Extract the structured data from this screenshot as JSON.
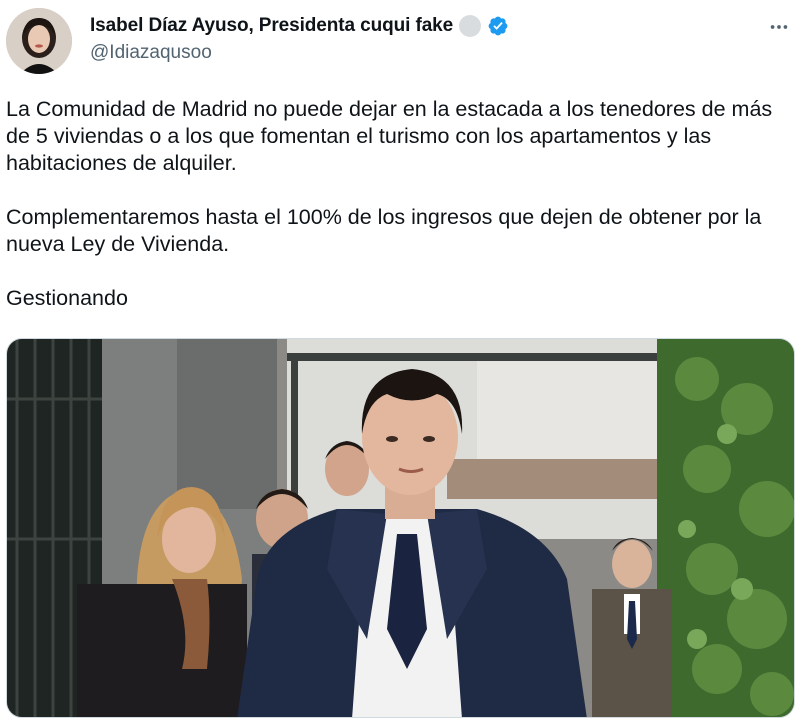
{
  "author": {
    "display_name": "Isabel Díaz Ayuso, Presidenta cuqui fake",
    "handle": "@Idiazaqusoo",
    "avatar_icon": "avatar-photo",
    "verified_icon": "verified-badge-icon",
    "badge_color": "#1d9bf0"
  },
  "tweet": {
    "paragraphs": [
      "La Comunidad de Madrid no puede dejar en la estacada a los tenedores de más de 5 viviendas o a los que fomentan el turismo con los apartamentos y las habitaciones de alquiler.",
      "Complementaremos hasta el 100% de los ingresos que dejen de obtener por la nueva Ley de Vivienda.",
      "Gestionando"
    ],
    "media": {
      "type": "photo",
      "icon": "photo-of-people-walking"
    }
  },
  "actions": {
    "more_icon": "more-options-icon"
  }
}
